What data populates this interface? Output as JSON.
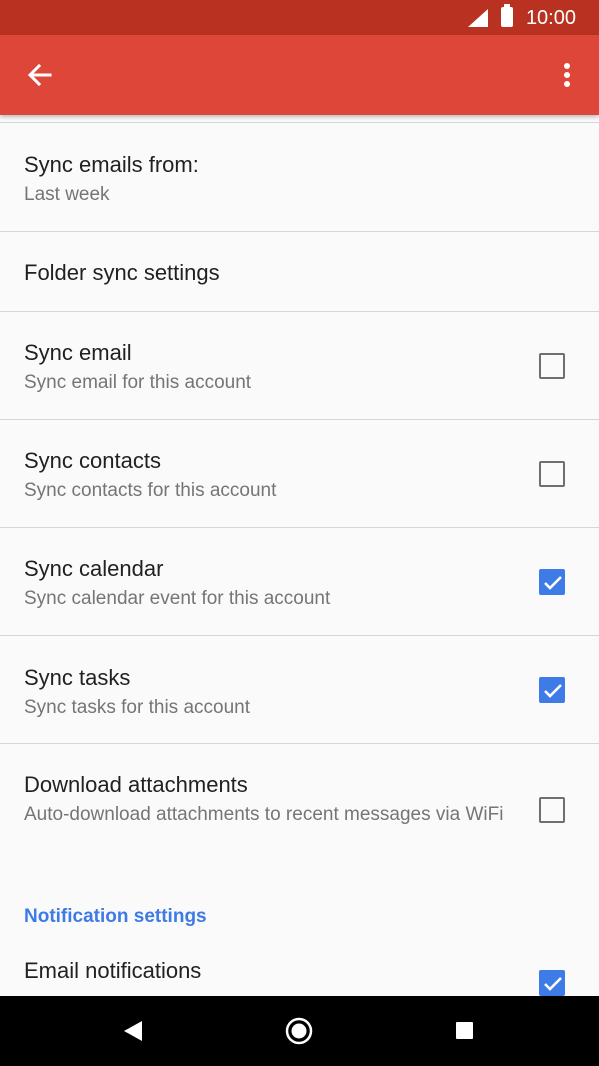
{
  "status_bar": {
    "time": "10:00"
  },
  "app_bar": {
    "back_icon": "arrow-left-icon",
    "menu_icon": "more-vert-icon"
  },
  "settings": {
    "sync_emails_from": {
      "title": "Sync emails from:",
      "value": "Last week"
    },
    "folder_sync": {
      "title": "Folder sync settings"
    },
    "sync_email": {
      "title": "Sync email",
      "summary": "Sync email for this account",
      "checked": false
    },
    "sync_contacts": {
      "title": "Sync contacts",
      "summary": "Sync contacts for this account",
      "checked": false
    },
    "sync_calendar": {
      "title": "Sync calendar",
      "summary": "Sync calendar event for this account",
      "checked": true
    },
    "sync_tasks": {
      "title": "Sync tasks",
      "summary": "Sync tasks for this account",
      "checked": true
    },
    "download_attachments": {
      "title": "Download attachments",
      "summary": "Auto-download attachments to recent messages via WiFi",
      "checked": false
    },
    "notification_header": "Notification settings",
    "email_notifications": {
      "title": "Email notifications",
      "checked": true
    }
  },
  "colors": {
    "status_bar": "#b93221",
    "app_bar": "#dd4638",
    "accent": "#3f7be7"
  }
}
